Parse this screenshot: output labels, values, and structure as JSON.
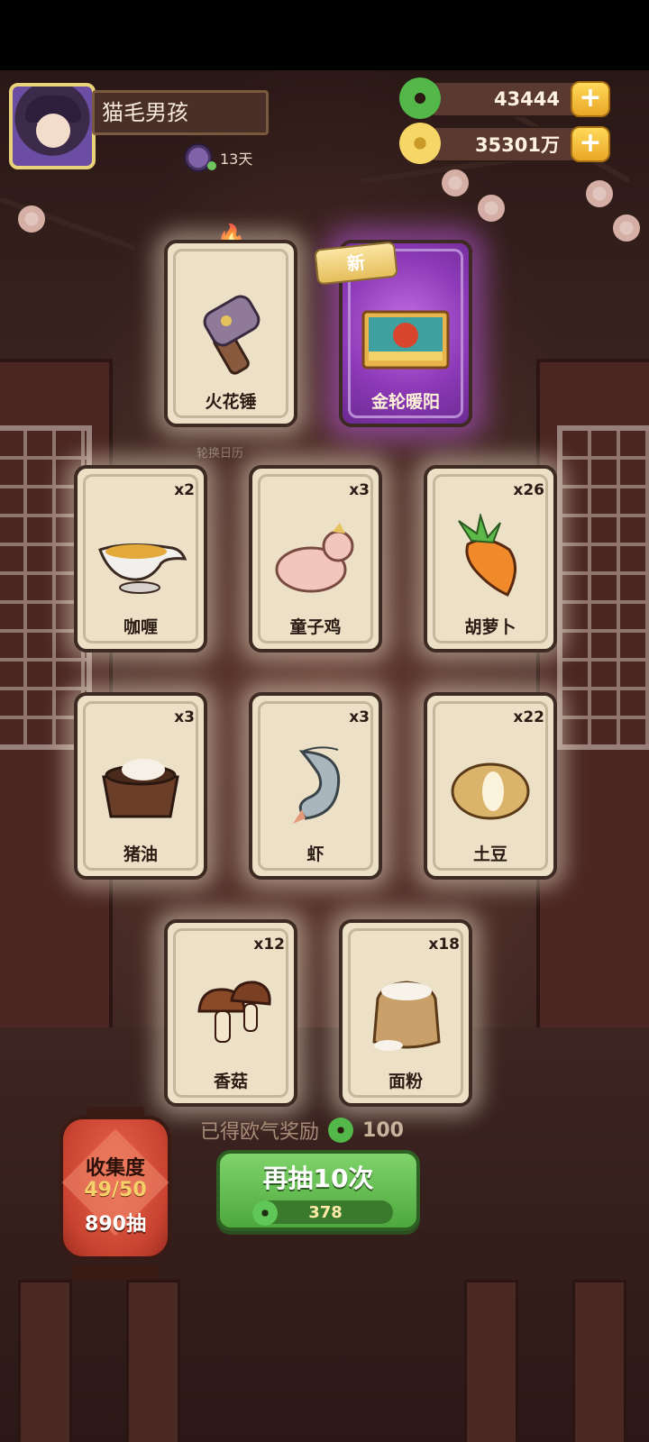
{
  "player": {
    "name": "猫毛男孩",
    "days": "13天"
  },
  "resources": {
    "jade": "43444",
    "coins": "35301万"
  },
  "featured": [
    {
      "label": "火花锤",
      "icon": "hammer"
    },
    {
      "label": "金轮暖阳",
      "icon": "scene-picture",
      "badge": "新"
    }
  ],
  "subcaption": "轮换日历",
  "cards_row1": [
    {
      "label": "咖喱",
      "count": "x2",
      "icon": "gravy-boat"
    },
    {
      "label": "童子鸡",
      "count": "x3",
      "icon": "chicken"
    },
    {
      "label": "胡萝卜",
      "count": "x26",
      "icon": "carrot"
    }
  ],
  "cards_row2": [
    {
      "label": "猪油",
      "count": "x3",
      "icon": "lard-bowl"
    },
    {
      "label": "虾",
      "count": "x3",
      "icon": "shrimp"
    },
    {
      "label": "土豆",
      "count": "x22",
      "icon": "potato"
    }
  ],
  "cards_row3": [
    {
      "label": "香菇",
      "count": "x12",
      "icon": "mushroom"
    },
    {
      "label": "面粉",
      "count": "x18",
      "icon": "flour-sack"
    }
  ],
  "reward": {
    "text": "已得欧气奖励",
    "amount": "100"
  },
  "draw_button": {
    "label": "再抽10次",
    "cost": "378"
  },
  "collection": {
    "title": "收集度",
    "progress": "49/50",
    "draws": "890抽"
  },
  "colors": {
    "accent_green": "#4ea83d",
    "card_bg": "#ece0c7",
    "rare_purple": "#8d3ab8"
  }
}
